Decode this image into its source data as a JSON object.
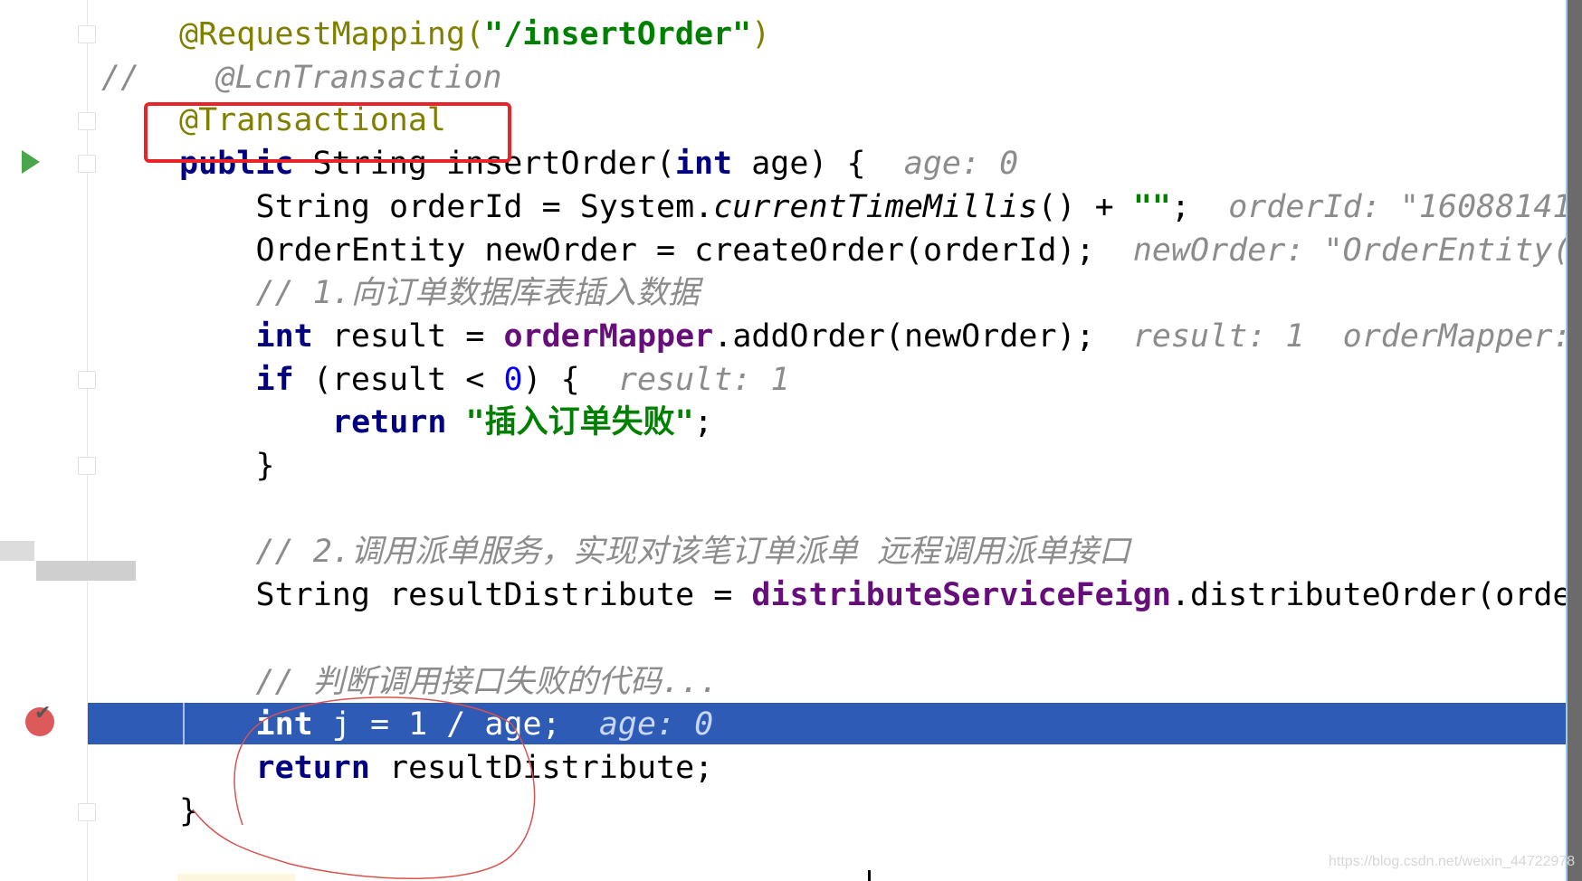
{
  "editor": {
    "lines": [
      {
        "indent": 0,
        "tokens": [
          [
            "@RequestMapping(",
            "a"
          ],
          [
            "\"/insertOrder\"",
            "s"
          ],
          [
            ")",
            "a"
          ]
        ]
      },
      {
        "indent": -1,
        "tokens": [
          [
            "//    ",
            "c"
          ],
          [
            "@LcnTransaction",
            "c"
          ]
        ]
      },
      {
        "indent": 0,
        "tokens": [
          [
            "@Transactional",
            "a"
          ]
        ]
      },
      {
        "indent": 0,
        "tokens": [
          [
            "public ",
            "k"
          ],
          [
            "String ",
            "p"
          ],
          [
            "insertOrder(",
            "p"
          ],
          [
            "int ",
            "k"
          ],
          [
            "age) {  ",
            "p"
          ],
          [
            "age: 0",
            "h"
          ]
        ]
      },
      {
        "indent": 1,
        "tokens": [
          [
            "String orderId = System.",
            "p"
          ],
          [
            "currentTimeMillis",
            "m"
          ],
          [
            "() + ",
            "p"
          ],
          [
            "\"\"",
            "s"
          ],
          [
            ";  ",
            "p"
          ],
          [
            "orderId: \"16088141",
            "h"
          ]
        ]
      },
      {
        "indent": 1,
        "tokens": [
          [
            "OrderEntity newOrder = createOrder(orderId);  ",
            "p"
          ],
          [
            "newOrder: \"OrderEntity(",
            "h"
          ]
        ]
      },
      {
        "indent": 1,
        "tokens": [
          [
            "// 1.向订单数据库表插入数据",
            "c"
          ]
        ]
      },
      {
        "indent": 1,
        "tokens": [
          [
            "int ",
            "k"
          ],
          [
            "result = ",
            "p"
          ],
          [
            "orderMapper",
            "f"
          ],
          [
            ".addOrder(newOrder);  ",
            "p"
          ],
          [
            "result: 1  orderMapper:",
            "h"
          ]
        ]
      },
      {
        "indent": 1,
        "tokens": [
          [
            "if ",
            "k"
          ],
          [
            "(result < ",
            "p"
          ],
          [
            "0",
            "n"
          ],
          [
            ") {  ",
            "p"
          ],
          [
            "result: 1",
            "h"
          ]
        ]
      },
      {
        "indent": 2,
        "tokens": [
          [
            "return ",
            "k"
          ],
          [
            "\"插入订单失败\"",
            "s"
          ],
          [
            ";",
            "p"
          ]
        ]
      },
      {
        "indent": 1,
        "tokens": [
          [
            "}",
            "p"
          ]
        ]
      },
      {
        "indent": 1,
        "tokens": []
      },
      {
        "indent": 1,
        "tokens": [
          [
            "// 2.调用派单服务，实现对该笔订单派单 远程调用派单接口",
            "c"
          ]
        ]
      },
      {
        "indent": 1,
        "tokens": [
          [
            "String resultDistribute = ",
            "p"
          ],
          [
            "distributeServiceFeign",
            "f"
          ],
          [
            ".distributeOrder(orde",
            "p"
          ]
        ]
      },
      {
        "indent": 1,
        "tokens": []
      },
      {
        "indent": 1,
        "tokens": [
          [
            "// 判断调用接口失败的代码...",
            "c"
          ]
        ]
      },
      {
        "indent": 1,
        "exec": true,
        "tokens": [
          [
            "int ",
            "k"
          ],
          [
            "j = 1 / age;  ",
            "p"
          ],
          [
            "age: 0",
            "h"
          ]
        ]
      },
      {
        "indent": 1,
        "tokens": [
          [
            "return ",
            "k"
          ],
          [
            "resultDistribute;",
            "p"
          ]
        ]
      },
      {
        "indent": 0,
        "tokens": [
          [
            "}",
            "p"
          ]
        ]
      }
    ]
  },
  "gutter": {
    "run_icon": "run-arrow-icon",
    "breakpoint_icon": "breakpoint-check-icon"
  },
  "colors": {
    "annotation": "#808000",
    "keyword": "#000080",
    "string": "#008000",
    "field": "#660e7a",
    "comment": "#8c8c8c",
    "execution_line": "#2d5bb5",
    "highlight_box": "#e8242a"
  },
  "watermark": "https://blog.csdn.net/weixin_44722978"
}
